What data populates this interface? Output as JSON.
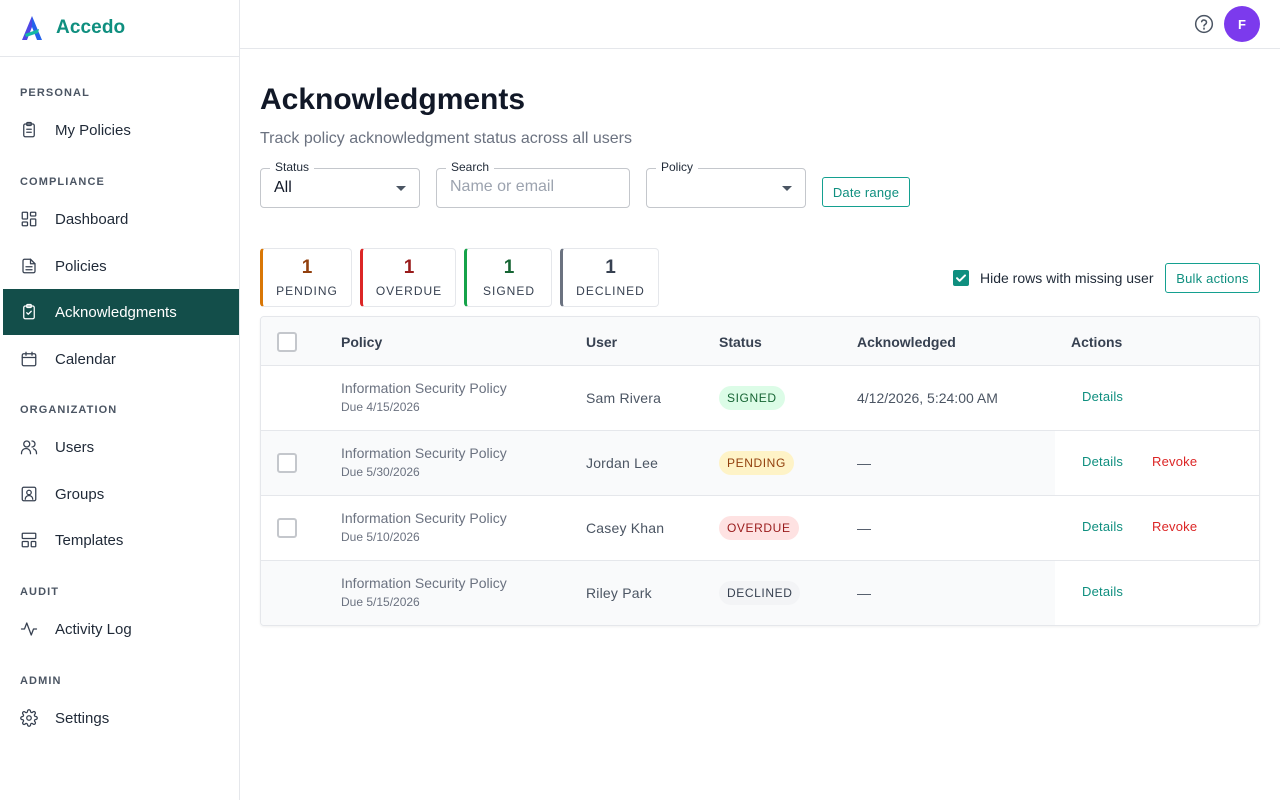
{
  "app": {
    "name": "Accedo",
    "avatar_initial": "F"
  },
  "sidebar": {
    "sections": [
      {
        "title": "PERSONAL"
      },
      {
        "title": "COMPLIANCE"
      },
      {
        "title": "ORGANIZATION"
      },
      {
        "title": "AUDIT"
      },
      {
        "title": "ADMIN"
      }
    ],
    "items": [
      {
        "label": "My Policies",
        "icon": "clipboard-icon"
      },
      {
        "label": "Dashboard",
        "icon": "dashboard-icon"
      },
      {
        "label": "Policies",
        "icon": "document-icon"
      },
      {
        "label": "Acknowledgments",
        "icon": "clipboard-check-icon",
        "active": true
      },
      {
        "label": "Calendar",
        "icon": "calendar-icon"
      },
      {
        "label": "Users",
        "icon": "users-icon"
      },
      {
        "label": "Groups",
        "icon": "groups-icon"
      },
      {
        "label": "Templates",
        "icon": "templates-icon"
      },
      {
        "label": "Activity Log",
        "icon": "activity-icon"
      },
      {
        "label": "Settings",
        "icon": "gear-icon"
      }
    ]
  },
  "page": {
    "title": "Acknowledgments",
    "subtitle": "Track policy acknowledgment status across all users"
  },
  "filters": {
    "status": {
      "label": "Status",
      "value": "All"
    },
    "search": {
      "label": "Search",
      "placeholder": "Name or email",
      "value": ""
    },
    "policy": {
      "label": "Policy",
      "value": ""
    },
    "date_range_label": "Date range"
  },
  "stats": [
    {
      "count": "1",
      "label": "PENDING",
      "color": "#d97706",
      "count_color": "#92400e"
    },
    {
      "count": "1",
      "label": "OVERDUE",
      "color": "#dc2626",
      "count_color": "#991b1b"
    },
    {
      "count": "1",
      "label": "SIGNED",
      "color": "#16a34a",
      "count_color": "#166534"
    },
    {
      "count": "1",
      "label": "DECLINED",
      "color": "#6b7280",
      "count_color": "#374151"
    }
  ],
  "options": {
    "hide_missing_label": "Hide rows with missing user",
    "hide_missing_checked": true,
    "bulk_actions_label": "Bulk actions"
  },
  "table": {
    "columns": [
      "Policy",
      "User",
      "Status",
      "Acknowledged",
      "Actions"
    ],
    "rows": [
      {
        "policy": "Information Security Policy",
        "due": "Due 4/15/2026",
        "user": "Sam Rivera",
        "status": "SIGNED",
        "acknowledged": "4/12/2026, 5:24:00 AM",
        "details": "Details",
        "revoke": ""
      },
      {
        "policy": "Information Security Policy",
        "due": "Due 5/30/2026",
        "user": "Jordan Lee",
        "status": "PENDING",
        "acknowledged": "—",
        "details": "Details",
        "revoke": "Revoke"
      },
      {
        "policy": "Information Security Policy",
        "due": "Due 5/10/2026",
        "user": "Casey Khan",
        "status": "OVERDUE",
        "acknowledged": "—",
        "details": "Details",
        "revoke": "Revoke"
      },
      {
        "policy": "Information Security Policy",
        "due": "Due 5/15/2026",
        "user": "Riley Park",
        "status": "DECLINED",
        "acknowledged": "—",
        "details": "Details",
        "revoke": ""
      }
    ]
  },
  "colors": {
    "brand": "#0f8f7f",
    "sidebar_active": "#134e4a",
    "signed_bg": "#dcfce7",
    "signed_fg": "#166534",
    "pending_bg": "#fef3c7",
    "pending_fg": "#92400e",
    "overdue_bg": "#fee2e2",
    "overdue_fg": "#991b1b",
    "declined_bg": "#f3f4f6",
    "declined_fg": "#374151"
  }
}
